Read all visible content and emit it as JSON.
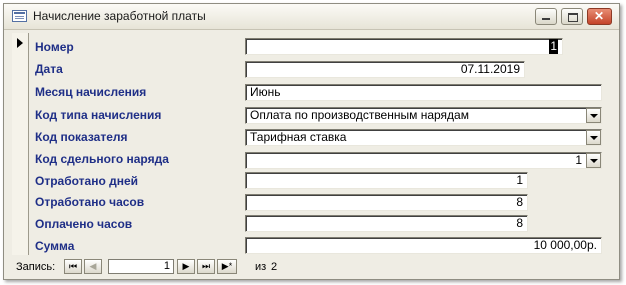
{
  "window": {
    "title": "Начисление заработной платы",
    "buttons": {
      "minimize": "minimize-icon",
      "maximize": "maximize-icon",
      "close": "close-icon"
    }
  },
  "form": {
    "fields": [
      {
        "label": "Номер",
        "value": "1"
      },
      {
        "label": "Дата",
        "value": "07.11.2019"
      },
      {
        "label": "Месяц начисления",
        "value": "Июнь"
      },
      {
        "label": "Код типа начисления",
        "value": "Оплата по производственным нарядам"
      },
      {
        "label": "Код показателя",
        "value": "Тарифная ставка"
      },
      {
        "label": "Код сдельного наряда",
        "value": "1"
      },
      {
        "label": "Отработано дней",
        "value": "1"
      },
      {
        "label": "Отработано часов",
        "value": "8"
      },
      {
        "label": "Оплачено часов",
        "value": "8"
      },
      {
        "label": "Сумма",
        "value": "10 000,00р."
      }
    ]
  },
  "navigation": {
    "label": "Запись:",
    "current": "1",
    "of_label": "из",
    "total": "2",
    "buttons": {
      "first": "⏮",
      "prev": "◀",
      "next": "▶",
      "last": "⏭",
      "new": "▶*"
    }
  },
  "colors": {
    "label": "#1f2f87",
    "background": "#efede4"
  }
}
